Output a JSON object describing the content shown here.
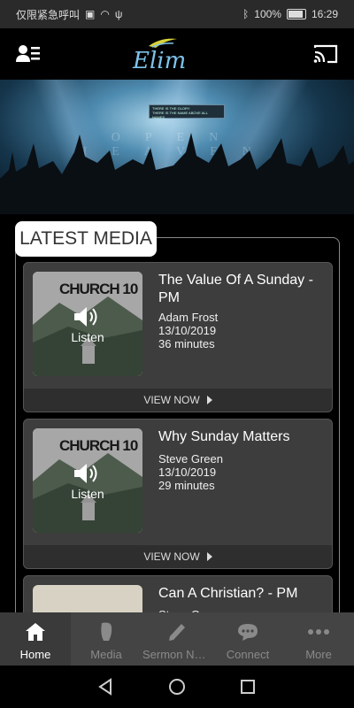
{
  "status": {
    "carrier": "仅限紧急呼叫",
    "battery": "100%",
    "time": "16:29"
  },
  "app": {
    "logo_text": "Elim"
  },
  "hero": {
    "screen_line1": "THERE IS THE GLORY",
    "screen_line2": "THERE IS THE NAME ABOVE ALL NAMES",
    "banner": "OPEN HEAVEN"
  },
  "section": {
    "label": "LATEST MEDIA"
  },
  "media": [
    {
      "thumb_title": "CHURCH 10",
      "listen": "Listen",
      "title": "The Value Of A Sunday - PM",
      "speaker": "Adam Frost",
      "date": "13/10/2019",
      "duration": "36 minutes",
      "view": "VIEW NOW"
    },
    {
      "thumb_title": "CHURCH 10",
      "listen": "Listen",
      "title": "Why Sunday Matters",
      "speaker": "Steve Green",
      "date": "13/10/2019",
      "duration": "29 minutes",
      "view": "VIEW NOW"
    },
    {
      "thumb_title": "",
      "listen": "",
      "title": "Can A Christian? - PM",
      "speaker": "Steve G...",
      "date": "",
      "duration": "",
      "view": ""
    }
  ],
  "tabs": [
    {
      "label": "Home"
    },
    {
      "label": "Media"
    },
    {
      "label": "Sermon Not…"
    },
    {
      "label": "Connect"
    },
    {
      "label": "More"
    }
  ],
  "colors": {
    "accent": "#7ec3ea",
    "card_bg": "#3d3d3d",
    "tabbar_bg": "#444444"
  }
}
